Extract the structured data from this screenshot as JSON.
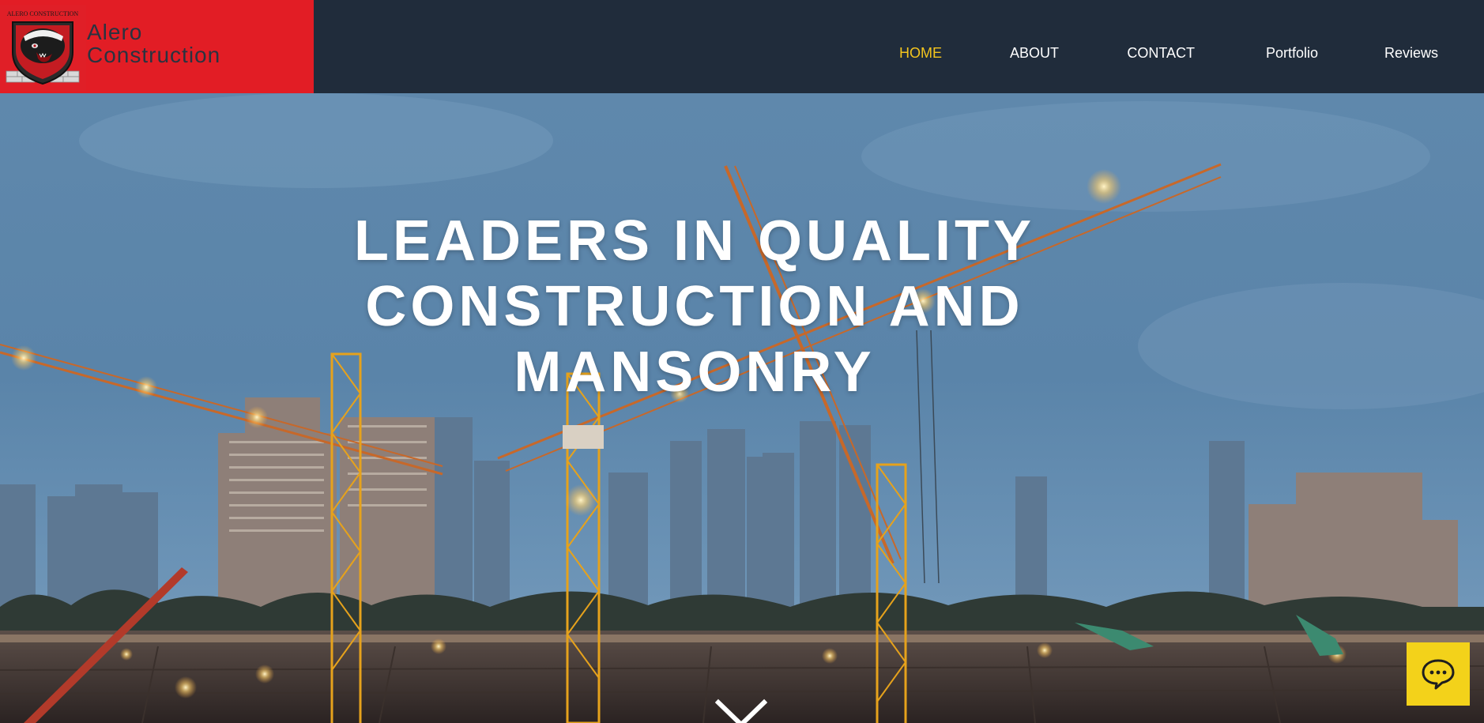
{
  "brand": {
    "name_line1": "Alero",
    "name_line2": "Construction",
    "logo_caption": "ALERO CONSTRUCTION",
    "brand_color": "#e21d25"
  },
  "nav": {
    "items": [
      {
        "label": "HOME",
        "active": true
      },
      {
        "label": "ABOUT",
        "active": false
      },
      {
        "label": "CONTACT",
        "active": false
      },
      {
        "label": "Portfolio",
        "active": false
      },
      {
        "label": "Reviews",
        "active": false
      }
    ],
    "active_color": "#f4c51d"
  },
  "hero": {
    "headline_line1": "LEADERS IN QUALITY",
    "headline_line2": "CONSTRUCTION AND",
    "headline_line3": "MANSONRY",
    "background": "construction-site-cranes-at-dusk",
    "scroll_icon": "chevron-down-icon"
  },
  "chat": {
    "icon": "chat-bubble-icon",
    "color": "#f3d21a"
  }
}
